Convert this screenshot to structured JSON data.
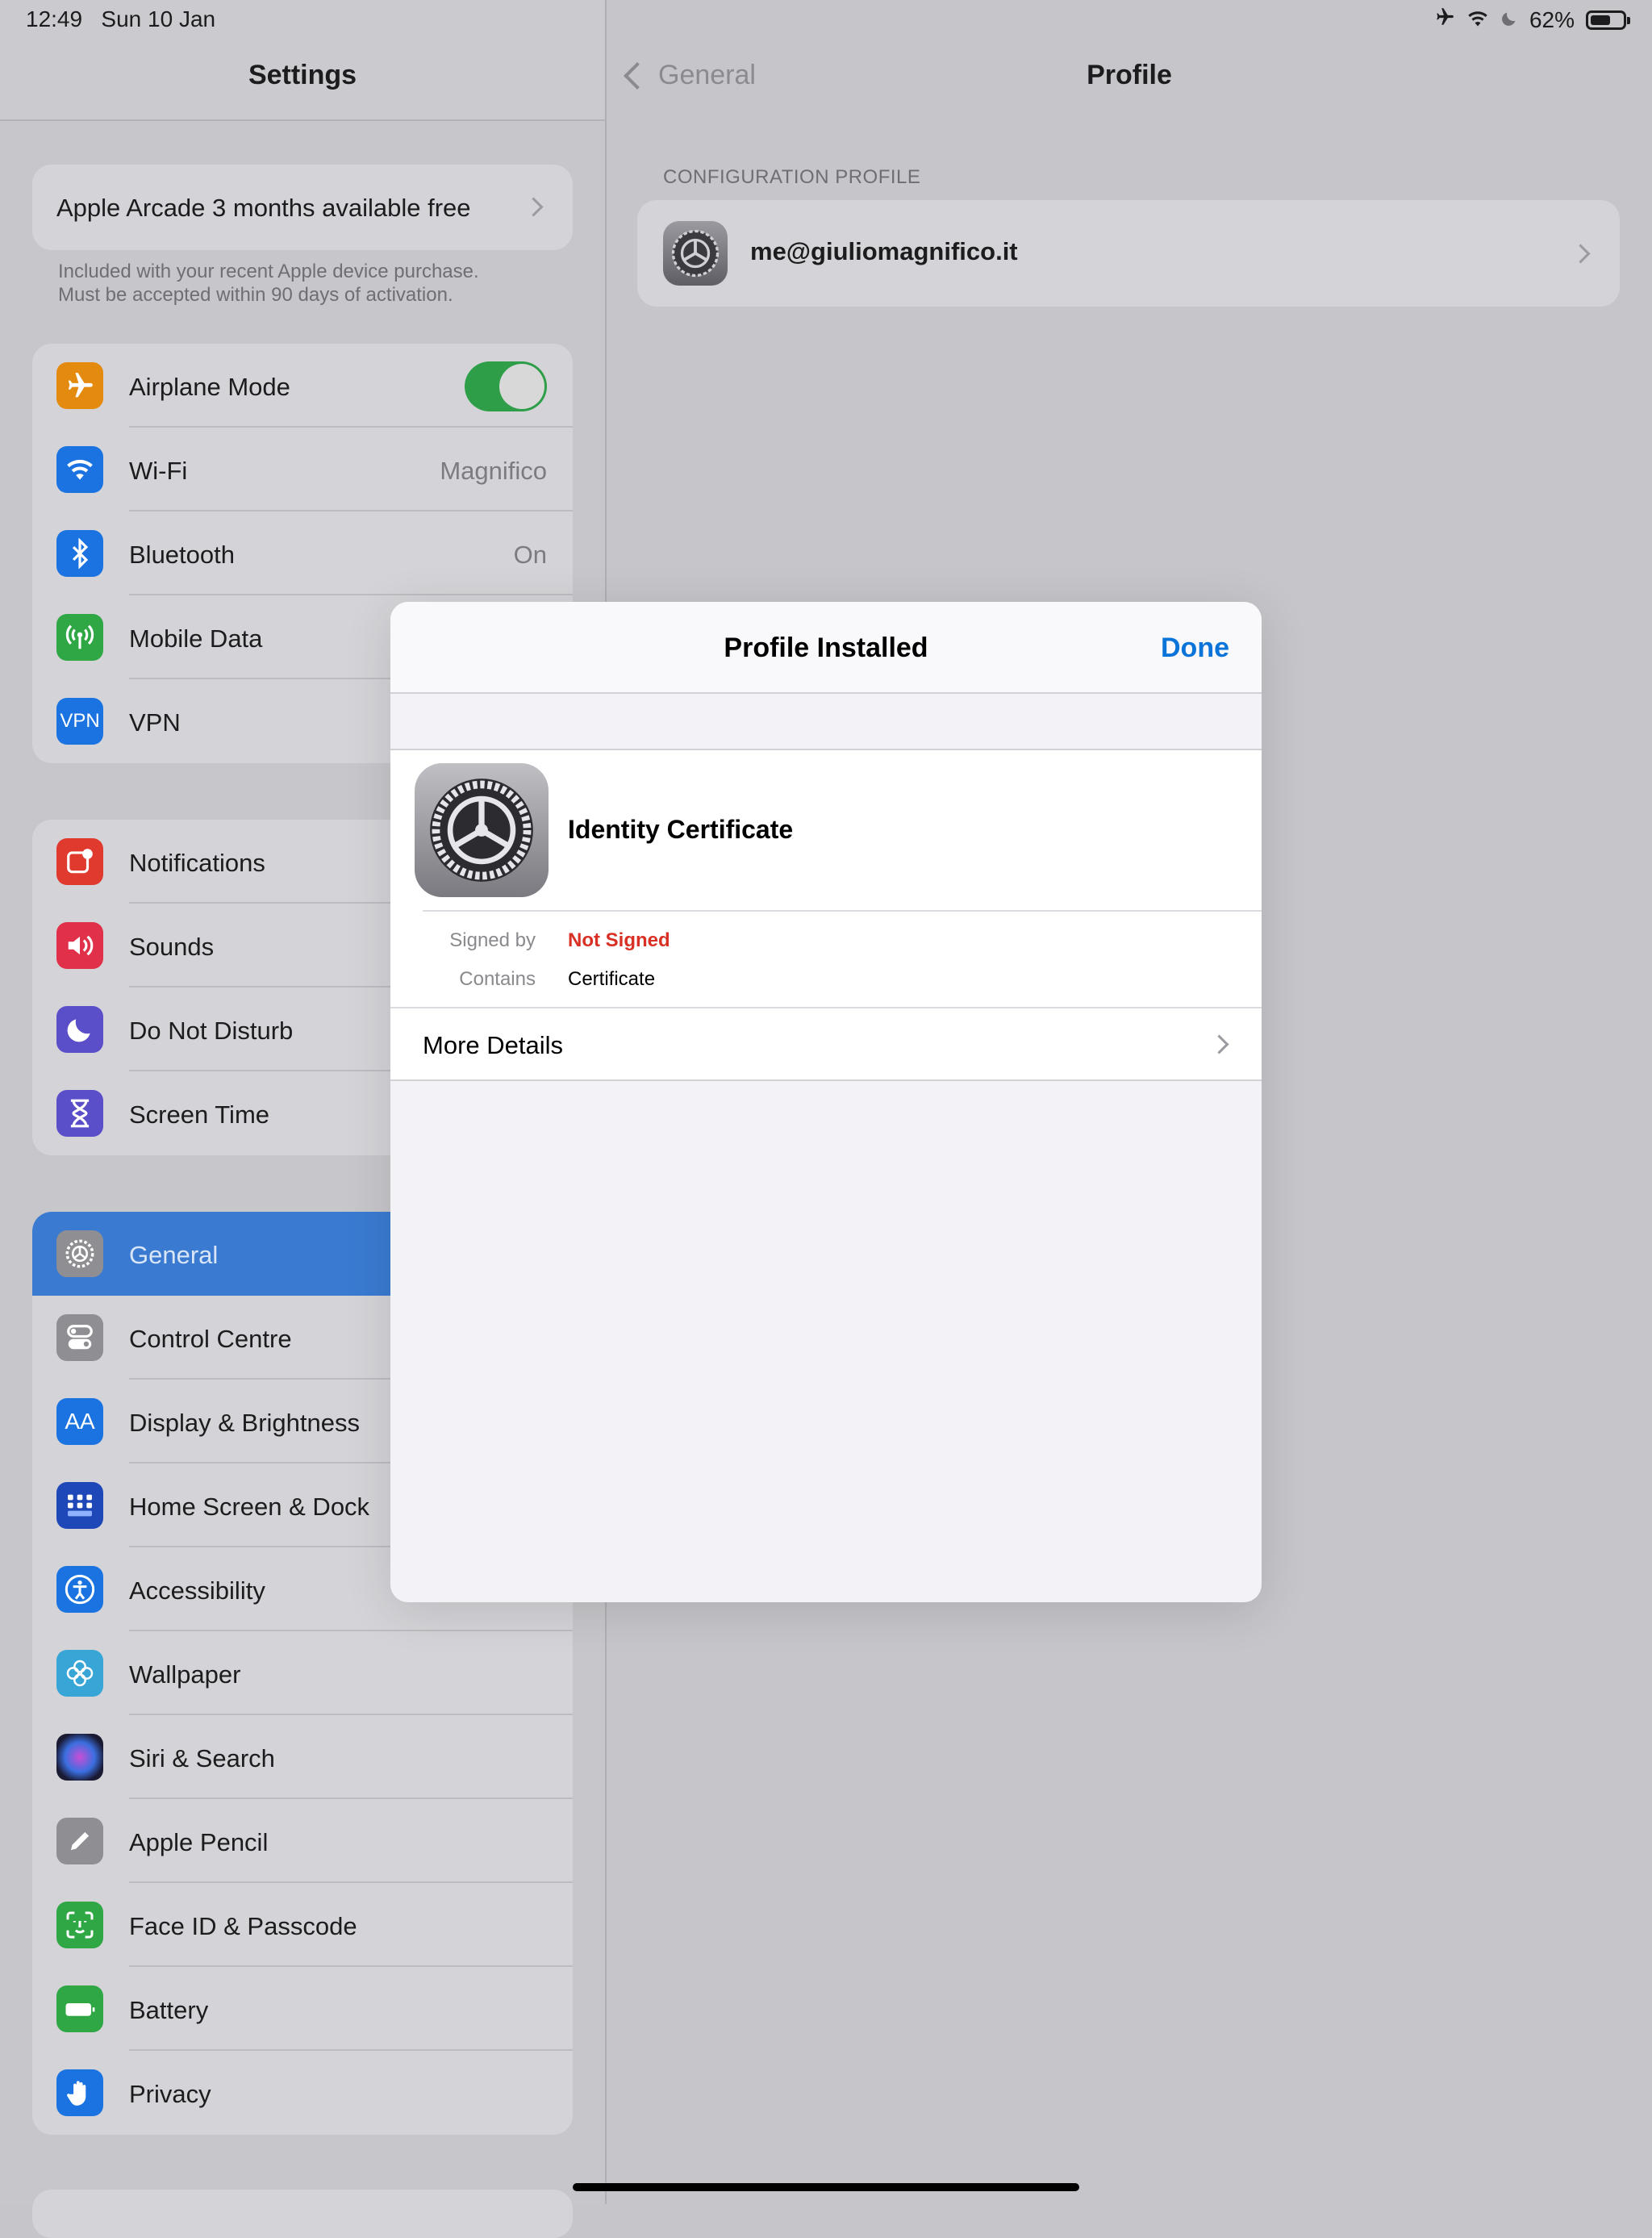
{
  "status_bar": {
    "time": "12:49",
    "date": "Sun 10 Jan",
    "battery_text": "62%",
    "battery_level": 0.62,
    "icons": [
      "airplane-icon",
      "wifi-icon",
      "moon-icon",
      "battery-icon"
    ]
  },
  "sidebar": {
    "title": "Settings",
    "arcade": {
      "label": "Apple Arcade 3 months available free",
      "note_line1": "Included with your recent Apple device purchase.",
      "note_line2": "Must be accepted within 90 days of activation."
    },
    "group1": [
      {
        "label": "Airplane Mode",
        "value": "",
        "icon": "airplane-icon",
        "color": "#e38a0f",
        "toggle_on": true
      },
      {
        "label": "Wi-Fi",
        "value": "Magnifico",
        "icon": "wifi-icon",
        "color": "#1a73e0"
      },
      {
        "label": "Bluetooth",
        "value": "On",
        "icon": "bluetooth-icon",
        "color": "#1a73e0"
      },
      {
        "label": "Mobile Data",
        "value": "",
        "icon": "antenna-icon",
        "color": "#2fa745"
      },
      {
        "label": "VPN",
        "value": "",
        "icon": "vpn-icon",
        "color": "#1a73e0",
        "icon_text": "VPN"
      }
    ],
    "group2": [
      {
        "label": "Notifications",
        "icon": "notifications-icon",
        "color": "#e03a2f"
      },
      {
        "label": "Sounds",
        "icon": "speaker-icon",
        "color": "#e0304a"
      },
      {
        "label": "Do Not Disturb",
        "icon": "moon-icon",
        "color": "#5b4fc9"
      },
      {
        "label": "Screen Time",
        "icon": "hourglass-icon",
        "color": "#5b4fc9"
      }
    ],
    "group3": [
      {
        "label": "General",
        "icon": "gear-icon",
        "color": "#8e8e93",
        "selected": true
      },
      {
        "label": "Control Centre",
        "icon": "toggles-icon",
        "color": "#8e8e93"
      },
      {
        "label": "Display & Brightness",
        "icon": "text-size-icon",
        "color": "#1a73e0",
        "icon_text": "AA"
      },
      {
        "label": "Home Screen & Dock",
        "icon": "grid-icon",
        "color": "#1e48b8"
      },
      {
        "label": "Accessibility",
        "icon": "accessibility-icon",
        "color": "#1a73e0"
      },
      {
        "label": "Wallpaper",
        "icon": "flower-icon",
        "color": "#37a6d6"
      },
      {
        "label": "Siri & Search",
        "icon": "siri-icon",
        "color": "#222244"
      },
      {
        "label": "Apple Pencil",
        "icon": "pencil-icon",
        "color": "#8e8e93"
      },
      {
        "label": "Face ID & Passcode",
        "icon": "face-id-icon",
        "color": "#2fa745"
      },
      {
        "label": "Battery",
        "icon": "battery-icon",
        "color": "#2fa745"
      },
      {
        "label": "Privacy",
        "icon": "hand-icon",
        "color": "#1a73e0"
      }
    ]
  },
  "detail": {
    "back_label": "General",
    "title": "Profile",
    "section_label": "CONFIGURATION PROFILE",
    "profile_email": "me@giuliomagnifico.it"
  },
  "modal": {
    "title": "Profile Installed",
    "done_label": "Done",
    "cert_name": "Identity Certificate",
    "signed_by_label": "Signed by",
    "signed_by_value": "Not Signed",
    "contains_label": "Contains",
    "contains_value": "Certificate",
    "more_details_label": "More Details"
  }
}
